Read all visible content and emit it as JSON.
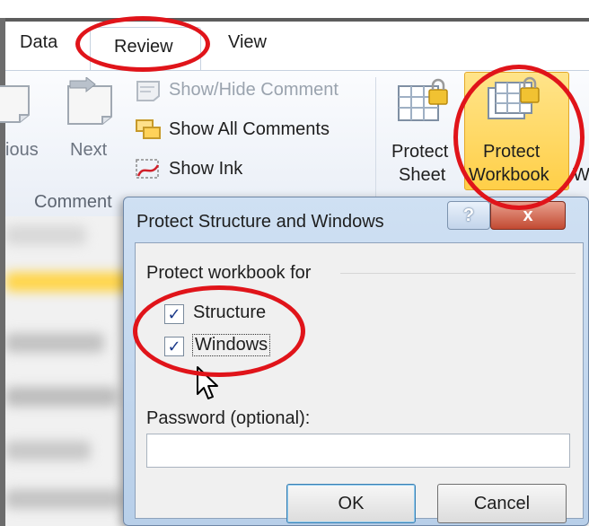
{
  "ribbon": {
    "tabs": [
      {
        "label": "Data"
      },
      {
        "label": "Review",
        "selected": true
      },
      {
        "label": "View"
      }
    ],
    "comments": {
      "previous_label": "ious",
      "next_label": "Next",
      "show_hide_comment": "Show/Hide Comment",
      "show_all_comments": "Show All Comments",
      "show_ink": "Show Ink",
      "group_label": "Comment"
    },
    "changes": {
      "protect_sheet_line1": "Protect",
      "protect_sheet_line2": "Sheet",
      "protect_workbook_line1": "Protect",
      "protect_workbook_line2": "Workbook",
      "clipped_next": "W"
    }
  },
  "dialog": {
    "title": "Protect Structure and Windows",
    "help_label": "?",
    "close_label": "x",
    "section_label": "Protect workbook for",
    "structure": {
      "label": "Structure",
      "checked": true
    },
    "windows": {
      "label": "Windows",
      "checked": true
    },
    "password_label": "Password (optional):",
    "password_value": "",
    "ok_label": "OK",
    "cancel_label": "Cancel"
  },
  "colors": {
    "annotation_red": "#e0141a",
    "highlight_gold": "#ffcf48",
    "dialog_frame": "#b8cfe9"
  },
  "icons": [
    "previous-comment-icon",
    "next-comment-icon",
    "comment-icon",
    "comments-icon",
    "ink-icon",
    "protect-sheet-icon",
    "protect-workbook-icon",
    "checkmark-icon",
    "mouse-cursor-icon"
  ]
}
